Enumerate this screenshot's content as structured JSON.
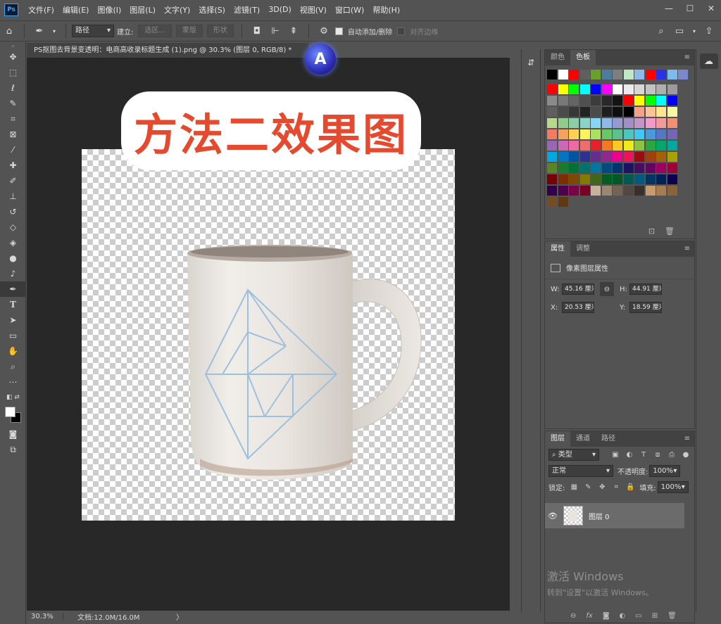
{
  "menubar": {
    "app_icon": "Ps",
    "items": [
      "文件(F)",
      "编辑(E)",
      "图像(I)",
      "图层(L)",
      "文字(Y)",
      "选择(S)",
      "滤镜(T)",
      "3D(D)",
      "视图(V)",
      "窗口(W)",
      "帮助(H)"
    ],
    "window_controls": [
      "—",
      "☐",
      "✕"
    ]
  },
  "optionsbar": {
    "mode": "路径",
    "make_label": "建立:",
    "selection_btn": "选区...",
    "mask_btn": "蒙版",
    "shape_btn": "形状",
    "auto_add_label": "自动添加/删除",
    "align_edges_label": "对齐边缘"
  },
  "document": {
    "tab_title": "PS抠图去背景变透明：电商高收录标题生成 (1).png @ 30.3% (图层 0, RGB/8) *",
    "overlay_title": "方法二效果图",
    "floating_logo": "A"
  },
  "statusbar": {
    "zoom": "30.3%",
    "doc_size": "文档:12.0M/16.0M",
    "arrow": "〉"
  },
  "swatch_panel": {
    "tabs": [
      "颜色",
      "色板"
    ],
    "active_tab": "色板",
    "rows": [
      [
        "#000000",
        "#ffffff",
        "#ff0000",
        "#5f5f5f",
        "#69a02a",
        "#4c7d9f",
        "#7e7e7e",
        "#bfe8c6",
        "#8fb9e8",
        "#ff0000",
        "#2832e6",
        "#7dbbee",
        "#7b89cc"
      ],
      [
        "#ff0000",
        "#ffff00",
        "#00ff00",
        "#00ffff",
        "#0000ff",
        "#ff00ff",
        "#ffffff",
        "#ebebeb",
        "#d7d7d7",
        "#c3c3c3",
        "#afafaf",
        "#9b9b9b"
      ],
      [
        "#8a8a8a",
        "#787878",
        "#646464",
        "#505050",
        "#3c3c3c",
        "#282828",
        "#141414",
        "#ff0000",
        "#ffff00",
        "#00ff00",
        "#00ffff",
        "#0000ff"
      ],
      [
        "#5f5f5f",
        "#4b4b4b",
        "#373737",
        "#232323",
        "#4b4b4b",
        "#1e1e1e",
        "#0f0f0f",
        "#000000",
        "#f5a185",
        "#f8c396",
        "#fde68f",
        "#f4f8a5"
      ],
      [
        "#b7d98c",
        "#92cc8c",
        "#8bcfa6",
        "#89d4c9",
        "#86d7f5",
        "#90b9e7",
        "#959ad1",
        "#a38fc7",
        "#c495c8",
        "#f29bc8",
        "#f39b9b",
        "#f19072"
      ],
      [
        "#f27b62",
        "#f5a25c",
        "#fbd350",
        "#f7f45c",
        "#ace05f",
        "#69c863",
        "#59c28f",
        "#4bc8bd",
        "#42c6f3",
        "#4b98dc",
        "#5676c3",
        "#7465b5"
      ],
      [
        "#9a65b5",
        "#cc69b4",
        "#ef6aa3",
        "#ef6d6d",
        "#e8202a",
        "#f47a22",
        "#fcc923",
        "#f1ea17",
        "#8bc43f",
        "#28a83f",
        "#00a86b",
        "#00a99d"
      ],
      [
        "#00a8e2",
        "#0076c0",
        "#0054a6",
        "#2e3191",
        "#662d91",
        "#92278f",
        "#ec008c",
        "#ed145b",
        "#9e0b0f",
        "#a0410d",
        "#a3620a",
        "#aba000"
      ],
      [
        "#598527",
        "#197b30",
        "#007236",
        "#00746b",
        "#0076a3",
        "#004b80",
        "#003471",
        "#1b1464",
        "#440e62",
        "#630460",
        "#9e005d",
        "#9e0039"
      ],
      [
        "#790000",
        "#7b2e00",
        "#7d4900",
        "#827b00",
        "#406618",
        "#005e20",
        "#005826",
        "#005952",
        "#005b7f",
        "#003663",
        "#002157",
        "#0d004c"
      ],
      [
        "#32004b",
        "#4b0049",
        "#7b0046",
        "#7a0026",
        "#c7b299",
        "#998675",
        "#736357",
        "#534741",
        "#37302d",
        "#c69c6d",
        "#a67c52",
        "#8c6239"
      ],
      [
        "#754c24",
        "#603913"
      ]
    ]
  },
  "props_panel": {
    "tabs": [
      "属性",
      "调整"
    ],
    "active_tab": "属性",
    "section_title": "像素图层属性",
    "w_label": "W:",
    "w_value": "45.16 厘米",
    "h_label": "H:",
    "h_value": "44.91 厘米",
    "x_label": "X:",
    "x_value": "20.53 厘米",
    "y_label": "Y:",
    "y_value": "18.59 厘米"
  },
  "layers_panel": {
    "tabs": [
      "图层",
      "通道",
      "路径"
    ],
    "active_tab": "图层",
    "filter_kind": "类型",
    "blend_mode": "正常",
    "opacity_label": "不透明度:",
    "opacity_value": "100%",
    "lock_label": "锁定:",
    "fill_label": "填充:",
    "fill_value": "100%",
    "layer_name": "图层 0"
  },
  "watermark": {
    "line1": "激活 Windows",
    "line2": "转到\"设置\"以激活 Windows。"
  }
}
